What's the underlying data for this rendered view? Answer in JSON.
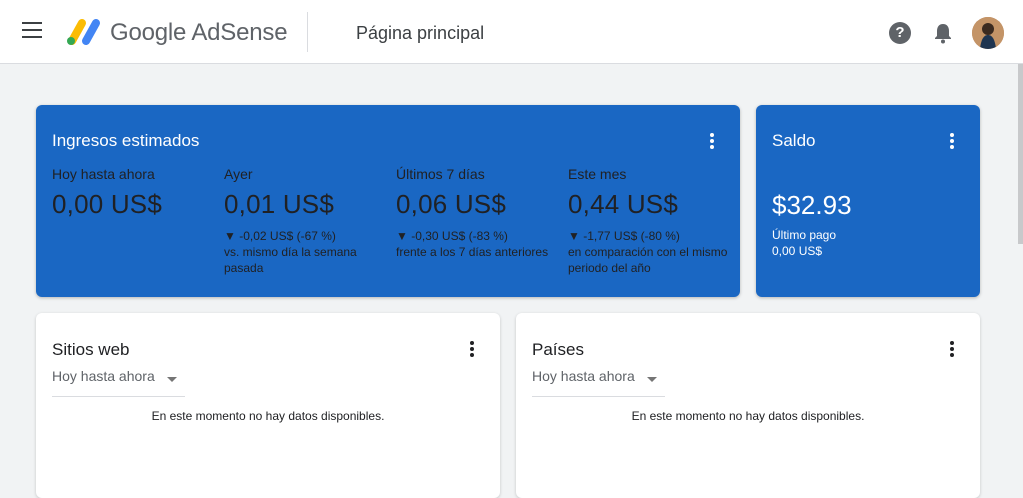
{
  "header": {
    "brand": "Google AdSense",
    "page_title": "Página principal",
    "icons": [
      "menu-icon",
      "help-icon",
      "notifications-icon",
      "avatar"
    ]
  },
  "colors": {
    "primary_card": "#1a67c3",
    "logo_yellow": "#fbbc04",
    "logo_blue": "#4285f4",
    "logo_green": "#34a853"
  },
  "earnings": {
    "title": "Ingresos estimados",
    "metrics": [
      {
        "label": "Hoy hasta ahora",
        "value": "0,00 US$",
        "change": "",
        "note": ""
      },
      {
        "label": "Ayer",
        "value": "0,01 US$",
        "change": "▼ -0,02 US$ (-67 %)",
        "note": "vs. mismo día la semana pasada"
      },
      {
        "label": "Últimos 7 días",
        "value": "0,06 US$",
        "change": "▼ -0,30 US$ (-83 %)",
        "note": "frente a los 7 días anteriores"
      },
      {
        "label": "Este mes",
        "value": "0,44 US$",
        "change": "▼ -1,77 US$ (-80 %)",
        "note": "en comparación con el mismo periodo del año"
      }
    ]
  },
  "balance": {
    "title": "Saldo",
    "value": "$32.93",
    "last_payment_label": "Último pago",
    "last_payment_value": "0,00 US$"
  },
  "sites": {
    "title": "Sitios web",
    "range": "Hoy hasta ahora",
    "empty": "En este momento no hay datos disponibles."
  },
  "countries": {
    "title": "Países",
    "range": "Hoy hasta ahora",
    "empty": "En este momento no hay datos disponibles."
  }
}
